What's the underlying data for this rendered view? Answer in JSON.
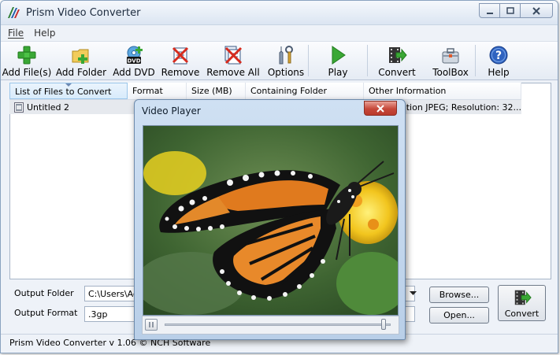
{
  "window": {
    "title": "Prism Video Converter"
  },
  "menu": [
    "File",
    "Help"
  ],
  "toolbar": {
    "add_files": "Add File(s)",
    "add_folder": "Add Folder",
    "add_dvd": "Add DVD",
    "remove": "Remove",
    "remove_all": "Remove All",
    "options": "Options",
    "play": "Play",
    "convert": "Convert",
    "toolbox": "ToolBox",
    "help": "Help",
    "dvd_badge": "DVD"
  },
  "file_list": {
    "columns": [
      "List of Files to Convert",
      "Format",
      "Size (MB)",
      "Containing Folder",
      "Other Information"
    ],
    "rows": [
      {
        "name": "Untitled 2",
        "other": "ation JPEG; Resolution: 32..."
      }
    ]
  },
  "bottom": {
    "output_folder_label": "Output Folder",
    "output_folder_value": "C:\\Users\\Ad",
    "output_format_label": "Output Format",
    "output_format_value": ".3gp",
    "browse": "Browse...",
    "open": "Open...",
    "convert": "Convert"
  },
  "status": {
    "text": "Prism Video Converter v 1.06 © NCH Software"
  },
  "video_player": {
    "title": "Video Player",
    "progress": 0.98
  },
  "colors": {
    "accent_green": "#3aa835",
    "close_red": "#c6483a",
    "selection_blue": "#d8ebfb"
  }
}
